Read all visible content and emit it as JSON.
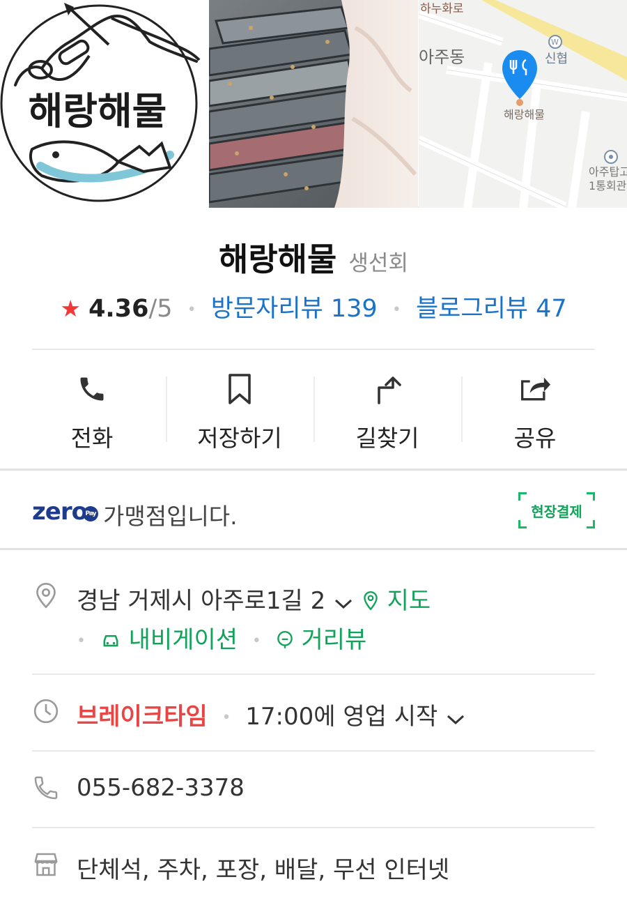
{
  "gallery": {
    "logo_text": "해랑해물",
    "map": {
      "road": "하누화로",
      "district": "아주동",
      "bank": "신협",
      "pin_label": "해랑해물",
      "landmark_line1": "아주탑고",
      "landmark_line2": "1통회관"
    }
  },
  "place": {
    "name": "해랑해물",
    "category": "생선회",
    "rating": "4.36",
    "rating_max": "/5",
    "visitor_reviews": "방문자리뷰 139",
    "blog_reviews": "블로그리뷰 47"
  },
  "actions": [
    {
      "label": "전화",
      "icon": "phone-icon"
    },
    {
      "label": "저장하기",
      "icon": "bookmark-icon"
    },
    {
      "label": "길찾기",
      "icon": "directions-icon"
    },
    {
      "label": "공유",
      "icon": "share-icon"
    }
  ],
  "zeropay": {
    "logo": "zero",
    "logo_badge": "Pay",
    "text": "가맹점입니다.",
    "badge": "현장결제"
  },
  "address": {
    "text": "경남 거제시 아주로1길 2",
    "map_link": "지도",
    "navigation_link": "내비게이션",
    "streetview_link": "거리뷰"
  },
  "hours": {
    "status": "브레이크타임",
    "text": "17:00에 영업 시작"
  },
  "phone": "055-682-3378",
  "amenities": "단체석, 주차, 포장, 배달, 무선 인터넷",
  "colors": {
    "accent_green": "#12a35a",
    "link_blue": "#1a73c9",
    "star_red": "#f03a3a",
    "status_red": "#e84545",
    "zeropay_blue": "#1f3b8c"
  }
}
